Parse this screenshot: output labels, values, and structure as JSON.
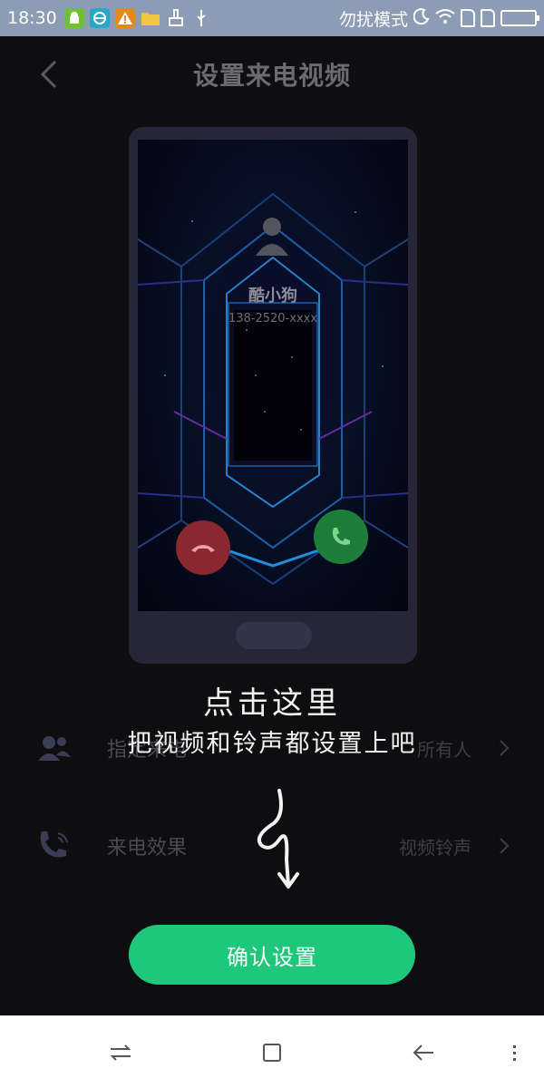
{
  "status_bar": {
    "time": "18:30",
    "notification_icons": [
      "android-app-icon",
      "browser-app-icon",
      "warning-icon",
      "folder-icon",
      "brush-icon",
      "usb-icon"
    ],
    "mode_text": "勿扰模式",
    "right_icons": [
      "moon-icon",
      "wifi-icon",
      "sim-icon",
      "sim-icon",
      "battery-icon"
    ]
  },
  "header": {
    "title": "设置来电视频",
    "back_icon": "chevron-left-icon"
  },
  "preview": {
    "caller_name": "酷小狗",
    "caller_number": "138-2520-xxxx",
    "decline_icon": "phone-hangup-icon",
    "accept_icon": "phone-accept-icon"
  },
  "settings": [
    {
      "icon": "contacts-icon",
      "label": "指定来电",
      "value": "所有人"
    },
    {
      "icon": "phone-ringing-icon",
      "label": "来电效果",
      "value": "视频铃声"
    }
  ],
  "hint": {
    "line1": "点击这里",
    "line2": "把视频和铃声都设置上吧"
  },
  "confirm_button": "确认设置",
  "nav_bar": [
    "switch-icon",
    "square-icon",
    "back-arrow-icon",
    "menu-icon"
  ],
  "colors": {
    "status_bar": "#8c9cb4",
    "background": "#0e0e10",
    "confirm": "#1ec77a",
    "decline": "#8a2730",
    "accept": "#1e7d39"
  }
}
